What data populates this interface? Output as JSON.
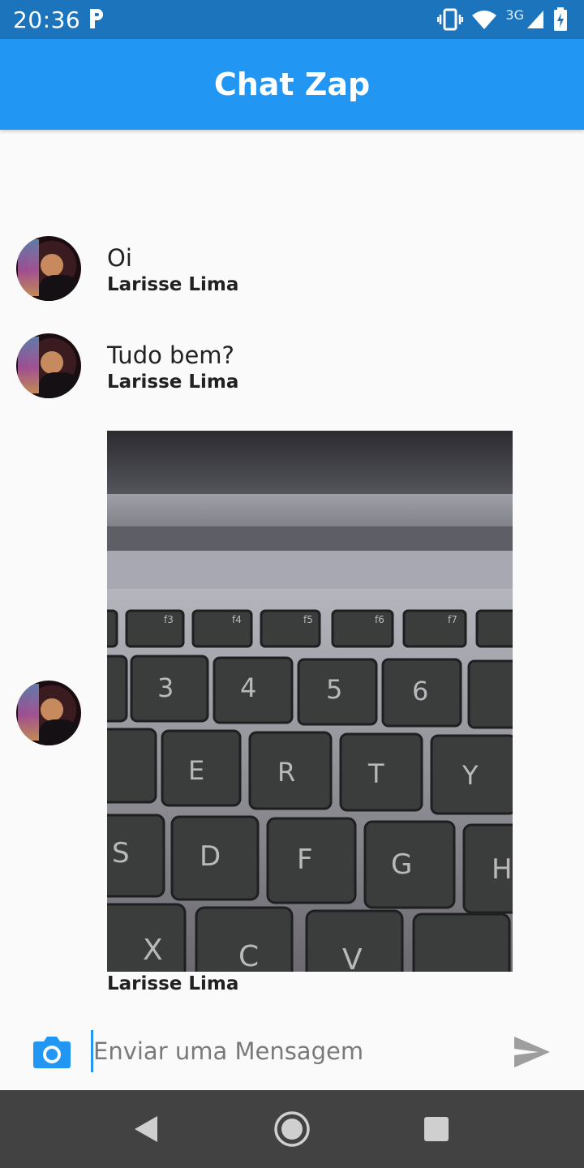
{
  "status_bar": {
    "time": "20:36",
    "network": "3G",
    "icons": [
      "parking-icon",
      "vibrate-icon",
      "wifi-icon",
      "signal-icon",
      "battery-charging-icon"
    ]
  },
  "app_bar": {
    "title": "Chat Zap"
  },
  "messages": [
    {
      "text": "Oi",
      "sender": "Larisse Lima",
      "type": "text"
    },
    {
      "text": "Tudo bem?",
      "sender": "Larisse Lima",
      "type": "text"
    },
    {
      "sender": "Larisse Lima",
      "type": "image",
      "image_desc_icon": "keyboard-photo"
    }
  ],
  "composer": {
    "placeholder": "Enviar uma Mensagem",
    "camera_icon": "camera-icon",
    "send_icon": "send-icon"
  },
  "nav_bar": {
    "icons": [
      "back-icon",
      "home-icon",
      "recents-icon"
    ]
  },
  "colors": {
    "primary": "#2196f3",
    "status_bar": "#1c74bd",
    "nav_bar": "#424242",
    "background": "#fafafa"
  }
}
